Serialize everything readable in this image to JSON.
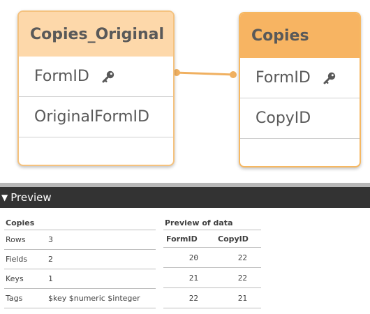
{
  "model": {
    "tables": [
      {
        "name": "Copies_Original",
        "fields": [
          {
            "label": "FormID",
            "is_key": true
          },
          {
            "label": "OriginalFormID",
            "is_key": false
          }
        ]
      },
      {
        "name": "Copies",
        "fields": [
          {
            "label": "FormID",
            "is_key": true
          },
          {
            "label": "CopyID",
            "is_key": false
          }
        ]
      }
    ],
    "colors": {
      "link": "#f0b060",
      "header_light": "#fdd8aa",
      "header_dark": "#f7b462"
    }
  },
  "preview": {
    "header_label": "Preview",
    "meta": {
      "title": "Copies",
      "rows": [
        {
          "key": "Rows",
          "value": "3"
        },
        {
          "key": "Fields",
          "value": "2"
        },
        {
          "key": "Keys",
          "value": "1"
        },
        {
          "key": "Tags",
          "value": "$key $numeric $integer"
        }
      ]
    },
    "data": {
      "title": "Preview of data",
      "columns": [
        "FormID",
        "CopyID"
      ],
      "rows": [
        [
          "20",
          "22"
        ],
        [
          "21",
          "22"
        ],
        [
          "22",
          "21"
        ]
      ]
    }
  }
}
